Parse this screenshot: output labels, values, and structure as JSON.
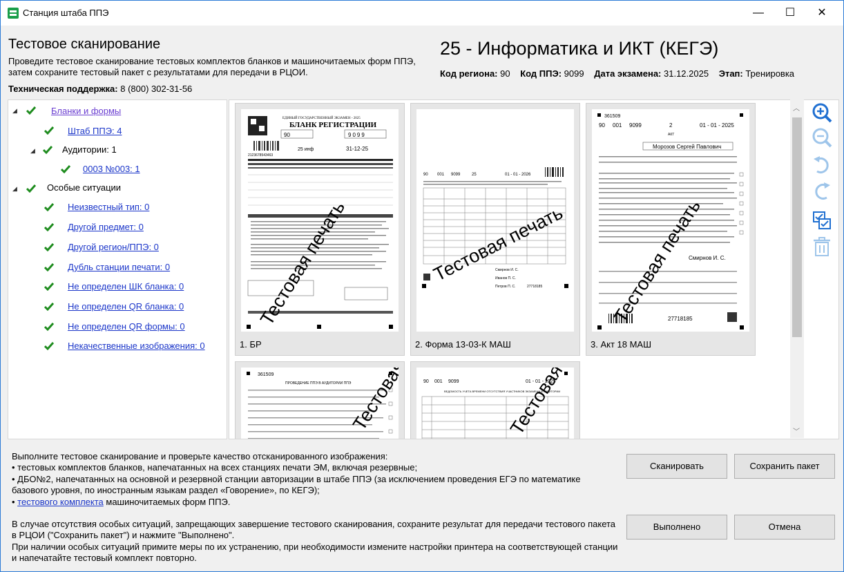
{
  "window": {
    "title": "Станция штаба ППЭ",
    "minimize_glyph": "—",
    "maximize_glyph": "☐",
    "close_glyph": "✕"
  },
  "header": {
    "title": "Тестовое сканирование",
    "description": "Проведите тестовое сканирование тестовых комплектов бланков и машиночитаемых форм ППЭ, затем сохраните тестовый пакет с результатами для передачи в РЦОИ.",
    "support_label": "Техническая поддержка:",
    "support_value": " 8 (800) 302-31-56",
    "subject": "25 - Информатика и ИКТ (КЕГЭ)",
    "region_label": "Код региона:",
    "region_value": " 90",
    "ppe_label": "Код ППЭ:",
    "ppe_value": " 9099",
    "date_label": "Дата экзамена:",
    "date_value": " 31.12.2025",
    "stage_label": "Этап:",
    "stage_value": " Тренировка"
  },
  "tree": {
    "root": "Бланки и формы",
    "hq": "Штаб ППЭ: 4",
    "auditoriums": "Аудитории: 1",
    "auditorium_1": "0003 №003: 1",
    "special": "Особые ситуации",
    "special_items": [
      "Неизвестный тип: 0",
      "Другой предмет: 0",
      "Другой регион/ППЭ: 0",
      "Дубль станции печати: 0",
      "Не определен ШК бланка: 0",
      "Не определен QR бланка: 0",
      "Не определен QR формы: 0",
      "Некачественные изображения: 0"
    ]
  },
  "thumbnails": [
    {
      "label": "1. БР"
    },
    {
      "label": "2. Форма 13-03-К МАШ"
    },
    {
      "label": "3. Акт 18 МАШ"
    },
    {
      "label": ""
    },
    {
      "label": ""
    }
  ],
  "stamp_text": "Тестовая печать",
  "page_text": {
    "br_header": "ЕДИНЫЙ ГОСУДАРСТВЕННЫЙ ЭКЗАМЕН - 2025",
    "br_title": "БЛАНК РЕГИСТРАЦИИ",
    "br_region": "90",
    "br_ppe": "9099",
    "br_date": "31-12-25",
    "br_subject": "25  инф",
    "br_barcode": "2123678543463",
    "f13_region": "90",
    "f13_code": "001",
    "f13_ppe": "9099",
    "f13_subject": "25",
    "f13_date": "01 - 01 - 2026",
    "f13_person1": "Смирнов И. С.",
    "f13_person2": "Иванов П. С.",
    "f13_person3": "Петров П. С.",
    "f13_code2": "27718185",
    "akt_number": "361509",
    "akt_region": "90",
    "akt_code": "001",
    "akt_ppe": "9099",
    "akt_num": "2",
    "akt_date": "01 - 01 - 2025",
    "akt_title": "АКТ",
    "akt_name": "Морозов Сергей Павлович",
    "akt_sign": "Смирнов И. С.",
    "akt_barcode": "27718185",
    "p4_number": "361509",
    "p4_title": "ПРОВЕДЕНИЕ ППЭ В АУДИТОРИИ ППЭ",
    "p5_region": "90",
    "p5_code": "001",
    "p5_ppe": "9099",
    "p5_date": "01 - 01 - 2025",
    "p5_title": "ВЕДОМОСТЬ УЧЕТА ВРЕМЕНИ ОТСУТСТВИЯ УЧАСТНИКОВ ЭКЗАМЕНА В АУДИТОРИИ"
  },
  "instructions": {
    "line1": "Выполните тестовое сканирование и проверьте качество отсканированного изображения:",
    "bullet1": " • тестовых комплектов бланков, напечатанных на всех станциях печати ЭМ, включая резервные;",
    "bullet2": " • ДБО№2, напечатанных на основной и резервной станции авторизации в штабе ППЭ (за исключением проведения ЕГЭ по математике базового уровня, по иностранным языкам раздел «Говорение», по КЕГЭ);",
    "bullet3_prefix": " • ",
    "bullet3_link": "тестового комплекта",
    "bullet3_suffix": " машиночитаемых форм ППЭ.",
    "para2": "В случае отсутствия особых ситуаций, запрещающих завершение тестового сканирования, сохраните результат для передачи тестового пакета в РЦОИ (\"Сохранить пакет\") и нажмите \"Выполнено\".",
    "para3": "При наличии особых ситуаций примите меры по их устранению, при необходимости измените настройки принтера на соответствующей станции и напечатайте тестовый комплект повторно."
  },
  "buttons": {
    "scan": "Сканировать",
    "save": "Сохранить пакет",
    "done": "Выполнено",
    "cancel": "Отмена"
  },
  "tools": [
    "zoom-in-icon",
    "zoom-out-icon",
    "rotate-left-icon",
    "rotate-right-icon",
    "select-all-icon",
    "delete-icon"
  ],
  "colors": {
    "accent": "#1f6fd1",
    "check": "#1e8c1e",
    "link": "#1a35c9",
    "disabled": "#9ec5ea"
  }
}
